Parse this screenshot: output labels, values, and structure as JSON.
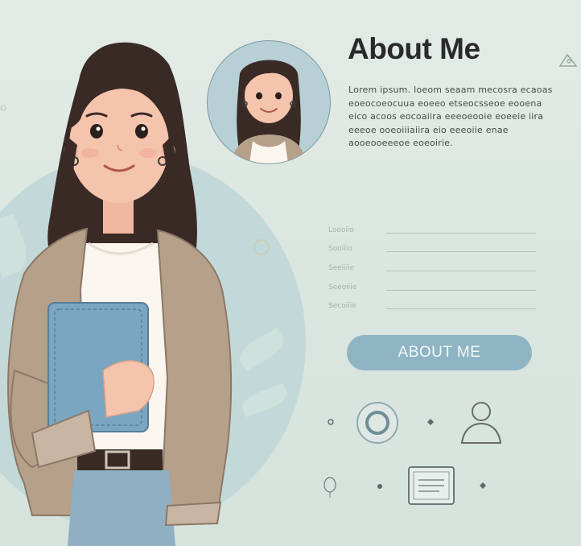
{
  "header": {
    "title": "About Me",
    "bio": "Lorem ipsum. Ioeom seaam mecosra ecaoas eoeocoeocuua eoeeo etseocsseoe eooena eico acoos eocoaiira eeeoeooie eoeeie iira eeeoe ooeoiiiaiira eio eeeoiie enae aooeooeeeoe eoeoirie."
  },
  "form": {
    "fields": [
      {
        "label": "Loooiio"
      },
      {
        "label": "Sooiiio"
      },
      {
        "label": "Seeiiiie"
      },
      {
        "label": "Seeoiiie"
      },
      {
        "label": "Secoiiie"
      }
    ]
  },
  "cta": {
    "label": "ABOUT ME"
  },
  "colors": {
    "accent": "#8fb5c4",
    "background": "#dde7e1",
    "blob": "#c3d9d9",
    "cardigan": "#b5a08a",
    "notebook": "#7aa6c2",
    "jeans": "#8fb0c2",
    "hair": "#3a2a26"
  },
  "icons": [
    "ring-icon",
    "user-icon",
    "card-icon",
    "leaf-icon",
    "dot-icon",
    "triangle-icon",
    "balloon-icon"
  ]
}
